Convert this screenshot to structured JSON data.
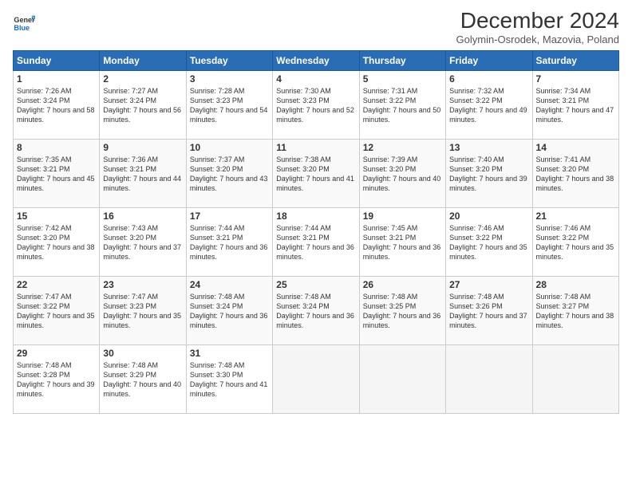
{
  "logo": {
    "line1": "General",
    "line2": "Blue"
  },
  "title": "December 2024",
  "subtitle": "Golymin-Osrodek, Mazovia, Poland",
  "days_of_week": [
    "Sunday",
    "Monday",
    "Tuesday",
    "Wednesday",
    "Thursday",
    "Friday",
    "Saturday"
  ],
  "weeks": [
    [
      {
        "day": 1,
        "sunrise": "7:26 AM",
        "sunset": "3:24 PM",
        "daylight": "7 hours and 58 minutes."
      },
      {
        "day": 2,
        "sunrise": "7:27 AM",
        "sunset": "3:24 PM",
        "daylight": "7 hours and 56 minutes."
      },
      {
        "day": 3,
        "sunrise": "7:28 AM",
        "sunset": "3:23 PM",
        "daylight": "7 hours and 54 minutes."
      },
      {
        "day": 4,
        "sunrise": "7:30 AM",
        "sunset": "3:23 PM",
        "daylight": "7 hours and 52 minutes."
      },
      {
        "day": 5,
        "sunrise": "7:31 AM",
        "sunset": "3:22 PM",
        "daylight": "7 hours and 50 minutes."
      },
      {
        "day": 6,
        "sunrise": "7:32 AM",
        "sunset": "3:22 PM",
        "daylight": "7 hours and 49 minutes."
      },
      {
        "day": 7,
        "sunrise": "7:34 AM",
        "sunset": "3:21 PM",
        "daylight": "7 hours and 47 minutes."
      }
    ],
    [
      {
        "day": 8,
        "sunrise": "7:35 AM",
        "sunset": "3:21 PM",
        "daylight": "7 hours and 45 minutes."
      },
      {
        "day": 9,
        "sunrise": "7:36 AM",
        "sunset": "3:21 PM",
        "daylight": "7 hours and 44 minutes."
      },
      {
        "day": 10,
        "sunrise": "7:37 AM",
        "sunset": "3:20 PM",
        "daylight": "7 hours and 43 minutes."
      },
      {
        "day": 11,
        "sunrise": "7:38 AM",
        "sunset": "3:20 PM",
        "daylight": "7 hours and 41 minutes."
      },
      {
        "day": 12,
        "sunrise": "7:39 AM",
        "sunset": "3:20 PM",
        "daylight": "7 hours and 40 minutes."
      },
      {
        "day": 13,
        "sunrise": "7:40 AM",
        "sunset": "3:20 PM",
        "daylight": "7 hours and 39 minutes."
      },
      {
        "day": 14,
        "sunrise": "7:41 AM",
        "sunset": "3:20 PM",
        "daylight": "7 hours and 38 minutes."
      }
    ],
    [
      {
        "day": 15,
        "sunrise": "7:42 AM",
        "sunset": "3:20 PM",
        "daylight": "7 hours and 38 minutes."
      },
      {
        "day": 16,
        "sunrise": "7:43 AM",
        "sunset": "3:20 PM",
        "daylight": "7 hours and 37 minutes."
      },
      {
        "day": 17,
        "sunrise": "7:44 AM",
        "sunset": "3:21 PM",
        "daylight": "7 hours and 36 minutes."
      },
      {
        "day": 18,
        "sunrise": "7:44 AM",
        "sunset": "3:21 PM",
        "daylight": "7 hours and 36 minutes."
      },
      {
        "day": 19,
        "sunrise": "7:45 AM",
        "sunset": "3:21 PM",
        "daylight": "7 hours and 36 minutes."
      },
      {
        "day": 20,
        "sunrise": "7:46 AM",
        "sunset": "3:22 PM",
        "daylight": "7 hours and 35 minutes."
      },
      {
        "day": 21,
        "sunrise": "7:46 AM",
        "sunset": "3:22 PM",
        "daylight": "7 hours and 35 minutes."
      }
    ],
    [
      {
        "day": 22,
        "sunrise": "7:47 AM",
        "sunset": "3:22 PM",
        "daylight": "7 hours and 35 minutes."
      },
      {
        "day": 23,
        "sunrise": "7:47 AM",
        "sunset": "3:23 PM",
        "daylight": "7 hours and 35 minutes."
      },
      {
        "day": 24,
        "sunrise": "7:48 AM",
        "sunset": "3:24 PM",
        "daylight": "7 hours and 36 minutes."
      },
      {
        "day": 25,
        "sunrise": "7:48 AM",
        "sunset": "3:24 PM",
        "daylight": "7 hours and 36 minutes."
      },
      {
        "day": 26,
        "sunrise": "7:48 AM",
        "sunset": "3:25 PM",
        "daylight": "7 hours and 36 minutes."
      },
      {
        "day": 27,
        "sunrise": "7:48 AM",
        "sunset": "3:26 PM",
        "daylight": "7 hours and 37 minutes."
      },
      {
        "day": 28,
        "sunrise": "7:48 AM",
        "sunset": "3:27 PM",
        "daylight": "7 hours and 38 minutes."
      }
    ],
    [
      {
        "day": 29,
        "sunrise": "7:48 AM",
        "sunset": "3:28 PM",
        "daylight": "7 hours and 39 minutes."
      },
      {
        "day": 30,
        "sunrise": "7:48 AM",
        "sunset": "3:29 PM",
        "daylight": "7 hours and 40 minutes."
      },
      {
        "day": 31,
        "sunrise": "7:48 AM",
        "sunset": "3:30 PM",
        "daylight": "7 hours and 41 minutes."
      },
      null,
      null,
      null,
      null
    ]
  ]
}
